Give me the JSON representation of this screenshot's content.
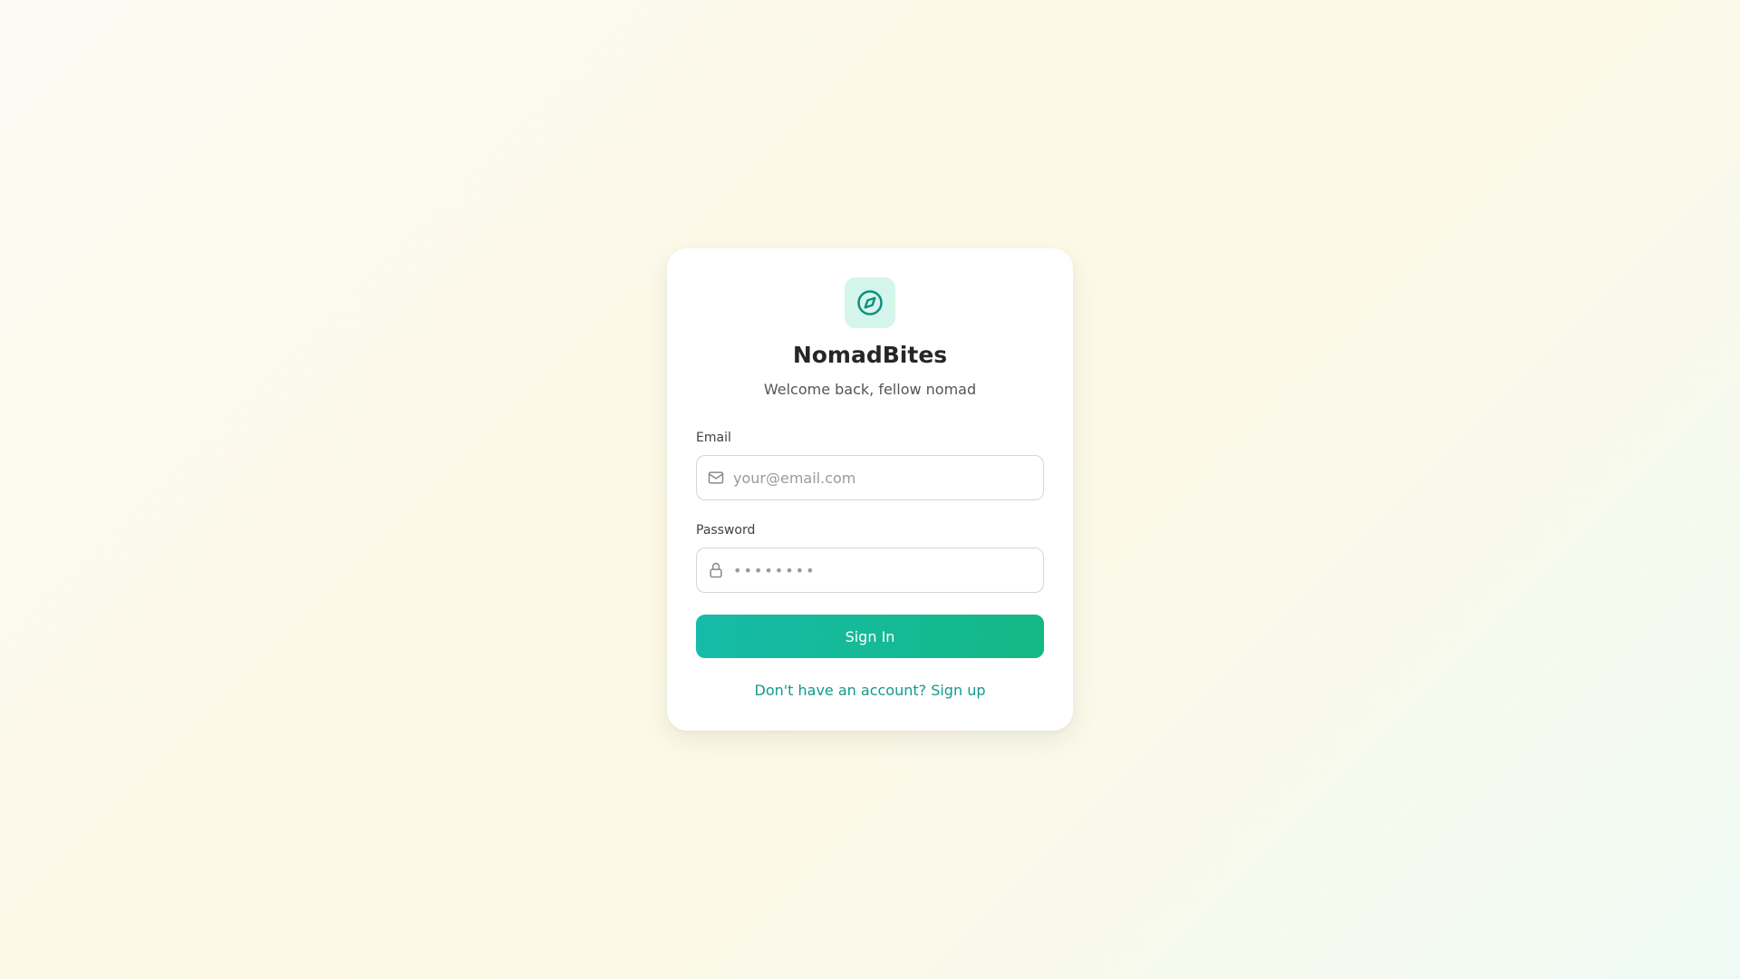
{
  "app": {
    "name": "NomadBites",
    "tagline": "Welcome back, fellow nomad",
    "logo_icon": "compass-icon",
    "accent_color": "#14b8a6",
    "accent_dark": "#0f8f7f"
  },
  "form": {
    "email": {
      "label": "Email",
      "placeholder": "your@email.com",
      "value": "",
      "icon": "mail-icon"
    },
    "password": {
      "label": "Password",
      "placeholder": "••••••••",
      "value": "",
      "icon": "lock-icon"
    },
    "submit_label": "Sign In"
  },
  "footer": {
    "signup_text": "Don't have an account? Sign up"
  }
}
